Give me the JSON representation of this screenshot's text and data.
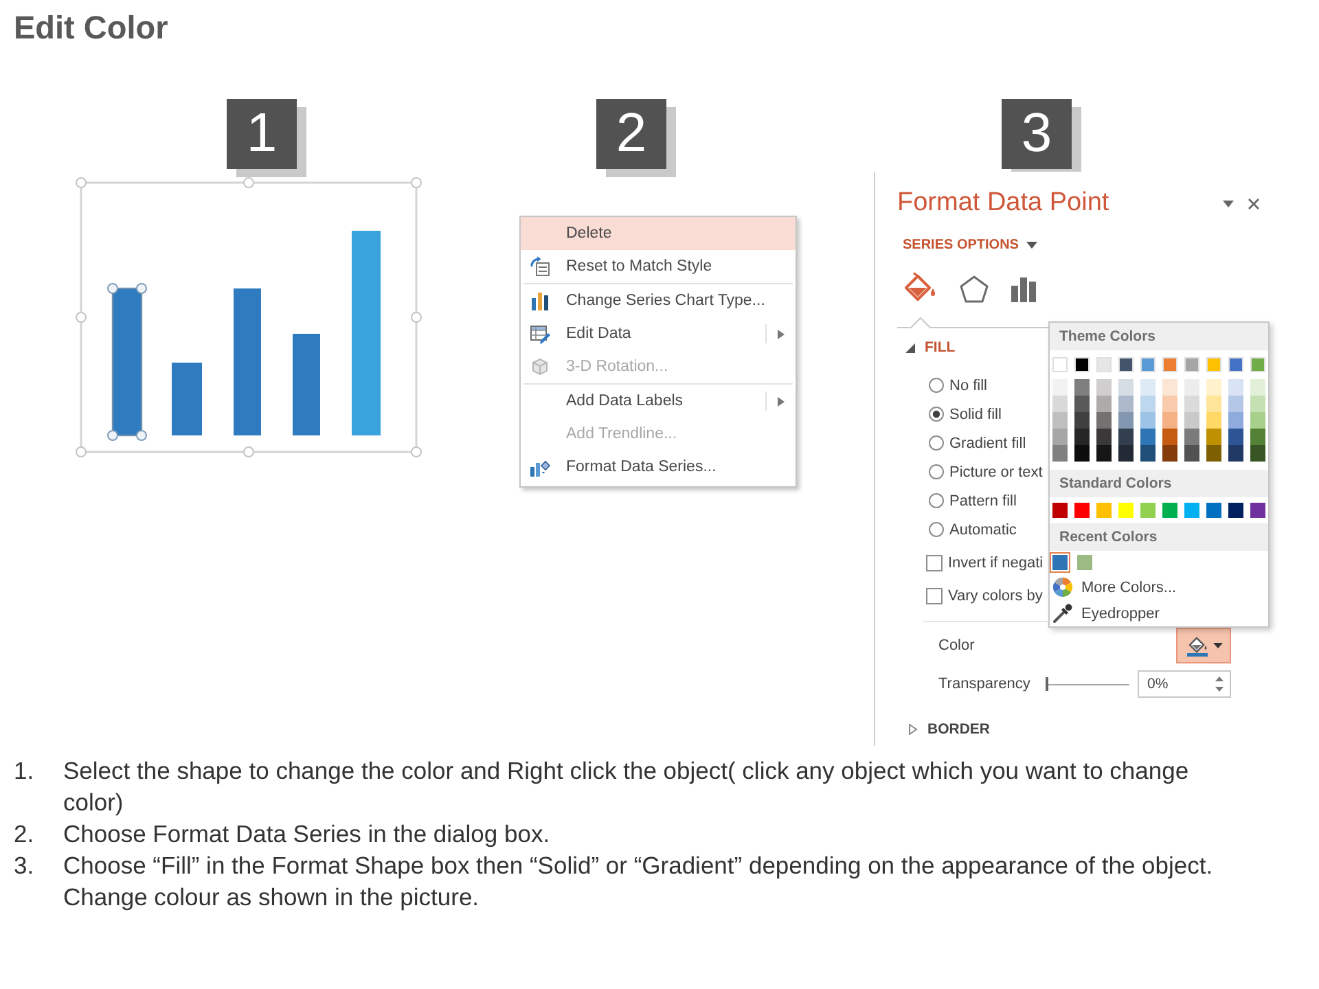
{
  "title": "Edit Color",
  "panels": [
    {
      "kind": "chart",
      "badge": "1",
      "bars": [
        {
          "color": "#2e7cbf",
          "selected": true
        },
        {
          "color": "#2e7cbf",
          "selected": false
        },
        {
          "color": "#2e7cbf",
          "selected": false
        },
        {
          "color": "#2e7cbf",
          "selected": false
        },
        {
          "color": "#39a3de",
          "selected": false
        }
      ]
    },
    {
      "kind": "context_menu",
      "badge": "2",
      "items": [
        {
          "kind": "command",
          "label": "Delete",
          "selected": true,
          "disabled": false,
          "submenu": false
        },
        {
          "kind": "command",
          "label": "Reset to Match Style",
          "selected": false,
          "disabled": false,
          "submenu": false
        },
        {
          "kind": "separator"
        },
        {
          "kind": "command",
          "label": "Change Series Chart Type...",
          "selected": false,
          "disabled": false,
          "submenu": false
        },
        {
          "kind": "command",
          "label": "Edit Data",
          "selected": false,
          "disabled": false,
          "submenu": true
        },
        {
          "kind": "command",
          "label": "3-D Rotation...",
          "selected": false,
          "disabled": true,
          "submenu": false
        },
        {
          "kind": "separator"
        },
        {
          "kind": "command",
          "label": "Add Data Labels",
          "selected": false,
          "disabled": false,
          "submenu": true
        },
        {
          "kind": "command",
          "label": "Add Trendline...",
          "selected": false,
          "disabled": true,
          "submenu": false
        },
        {
          "kind": "command",
          "label": "Format Data Series...",
          "selected": false,
          "disabled": false,
          "submenu": false
        }
      ]
    },
    {
      "kind": "format_pane",
      "badge": "3",
      "title": "Format Data Point",
      "subtitle": "SERIES OPTIONS",
      "tabs": [
        {
          "selected": true
        },
        {
          "selected": false
        },
        {
          "selected": false
        }
      ],
      "fill_section": {
        "label": "FILL",
        "expanded": true
      },
      "fill_options": [
        {
          "label": "No fill",
          "selected": false
        },
        {
          "label": "Solid fill",
          "selected": true
        },
        {
          "label": "Gradient fill",
          "selected": false
        },
        {
          "label": "Picture or text",
          "selected": false
        },
        {
          "label": "Pattern fill",
          "selected": false
        },
        {
          "label": "Automatic",
          "selected": false
        }
      ],
      "checkboxes": [
        {
          "label": "Invert if negati",
          "checked": false
        },
        {
          "label": "Vary colors by",
          "checked": false
        }
      ],
      "color": {
        "label": "Color",
        "open": true
      },
      "transparency": {
        "label": "Transparency",
        "level": 0,
        "value": "0%"
      },
      "border_section": {
        "label": "BORDER",
        "expanded": false
      },
      "palette": {
        "theme_label": "Theme Colors",
        "theme_row": [
          {
            "color": "#ffffff"
          },
          {
            "color": "#000000"
          },
          {
            "color": "#e7e6e6"
          },
          {
            "color": "#44546a"
          },
          {
            "color": "#5b9bd5"
          },
          {
            "color": "#ed7d31"
          },
          {
            "color": "#a5a5a5"
          },
          {
            "color": "#ffc000"
          },
          {
            "color": "#4472c4"
          },
          {
            "color": "#70ad47"
          }
        ],
        "theme_shades": [
          [
            {
              "color": "#f2f2f2"
            },
            {
              "color": "#7f7f7f"
            },
            {
              "color": "#d0cece"
            },
            {
              "color": "#d6dce4"
            },
            {
              "color": "#deebf6"
            },
            {
              "color": "#fbe5d5"
            },
            {
              "color": "#ededed"
            },
            {
              "color": "#fff2cc"
            },
            {
              "color": "#dae3f3"
            },
            {
              "color": "#e2efd9"
            }
          ],
          [
            {
              "color": "#d9d9d9"
            },
            {
              "color": "#595959"
            },
            {
              "color": "#aeabab"
            },
            {
              "color": "#adb9ca"
            },
            {
              "color": "#bdd7ee"
            },
            {
              "color": "#f7cbac"
            },
            {
              "color": "#dbdbdb"
            },
            {
              "color": "#fee599"
            },
            {
              "color": "#b4c7e7"
            },
            {
              "color": "#c5e0b3"
            }
          ],
          [
            {
              "color": "#bfbfbf"
            },
            {
              "color": "#404040"
            },
            {
              "color": "#757171"
            },
            {
              "color": "#8497b0"
            },
            {
              "color": "#9dc3e6"
            },
            {
              "color": "#f4b183"
            },
            {
              "color": "#c9c9c9"
            },
            {
              "color": "#ffd965"
            },
            {
              "color": "#8faadc"
            },
            {
              "color": "#a8d08d"
            }
          ],
          [
            {
              "color": "#a6a6a6"
            },
            {
              "color": "#262626"
            },
            {
              "color": "#3a3838"
            },
            {
              "color": "#333f4f"
            },
            {
              "color": "#2e75b5"
            },
            {
              "color": "#c55a11"
            },
            {
              "color": "#7b7b7b"
            },
            {
              "color": "#bf9000"
            },
            {
              "color": "#2f5496"
            },
            {
              "color": "#538135"
            }
          ],
          [
            {
              "color": "#808080"
            },
            {
              "color": "#0d0d0d"
            },
            {
              "color": "#171616"
            },
            {
              "color": "#222a35"
            },
            {
              "color": "#1f4e79"
            },
            {
              "color": "#843c0b"
            },
            {
              "color": "#525252"
            },
            {
              "color": "#7f6000"
            },
            {
              "color": "#203864"
            },
            {
              "color": "#375623"
            }
          ]
        ],
        "standard_label": "Standard Colors",
        "standard": [
          {
            "color": "#c00000"
          },
          {
            "color": "#ff0000"
          },
          {
            "color": "#ffc000"
          },
          {
            "color": "#ffff00"
          },
          {
            "color": "#92d050"
          },
          {
            "color": "#00b050"
          },
          {
            "color": "#00b0f0"
          },
          {
            "color": "#0070c0"
          },
          {
            "color": "#002060"
          },
          {
            "color": "#7030a0"
          }
        ],
        "recent_label": "Recent Colors",
        "recent": [
          {
            "color": "#2e75b6",
            "selected": true
          },
          {
            "color": "#9cbb84",
            "selected": false
          }
        ],
        "more_colors": "More Colors...",
        "eyedropper": "Eyedropper"
      }
    }
  ],
  "instructions": [
    {
      "number": "1.",
      "text": "Select the shape to change the color and Right click the object( click any object which you want to change color)"
    },
    {
      "number": "2.",
      "text": "Choose Format Data Series in the dialog box."
    },
    {
      "number": "3.",
      "text": "Choose “Fill” in the Format Shape box then “Solid” or “Gradient” depending on the appearance of the object. Change colour as shown in the picture."
    }
  ]
}
